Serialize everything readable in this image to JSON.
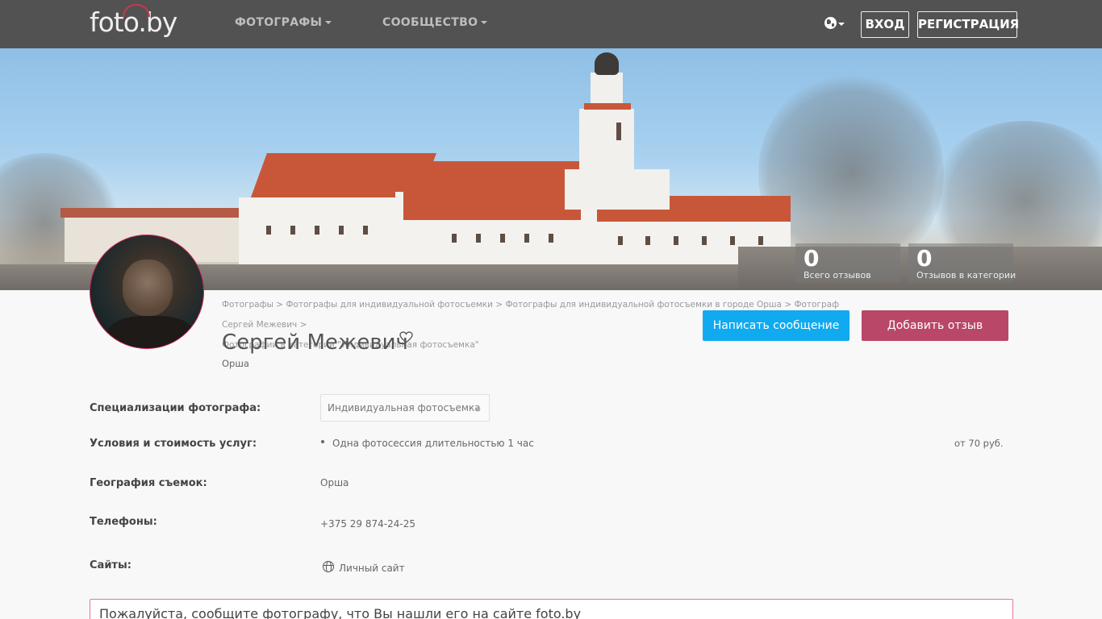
{
  "header": {
    "logo": "foto.by",
    "nav": [
      {
        "label": "ФОТОГРАФЫ"
      },
      {
        "label": "СООБЩЕСТВО"
      }
    ],
    "language_icon": "globe-icon",
    "login_label": "ВХОД",
    "register_label": "РЕГИСТРАЦИЯ"
  },
  "stats": [
    {
      "value": "0",
      "label": "Всего отзывов"
    },
    {
      "value": "0",
      "label": "Отзывов в категории"
    }
  ],
  "breadcrumb": {
    "items": [
      "Фотографы",
      "Фотографы для индивидуальной фотосъемки",
      "Фотографы для индивидуальной фотосъемки в городе Орша",
      "Фотограф Сергей Межевич"
    ],
    "separator": ">",
    "current": "Фотографии в категории \"Индивидуальная фотосъемка\""
  },
  "profile": {
    "name": "Сергей Межевич",
    "city": "Орша",
    "favorite_icon": "heart-icon"
  },
  "actions": {
    "message_label": "Написать сообщение",
    "review_label": "Добавить отзыв"
  },
  "details": {
    "specialization": {
      "label": "Специализации фотографа:",
      "selected": "Индивидуальная фотосъемка"
    },
    "services": {
      "label": "Условия и стоимость услуг:",
      "items": [
        {
          "name": "Одна фотосессия длительностью 1 час",
          "price": "от 70 руб."
        }
      ]
    },
    "geography": {
      "label": "География съемок:",
      "value": "Орша"
    },
    "phones": {
      "label": "Телефоны:",
      "value": "+375 29 874-24-25"
    },
    "sites": {
      "label": "Сайты:",
      "link_label": "Личный сайт",
      "icon": "globe-icon"
    }
  },
  "notice": {
    "text": "Пожалуйста, сообщите фотографу, что Вы нашли его на сайте foto.by"
  },
  "colors": {
    "topbar": "#525252",
    "message_button": "#10aaf0",
    "review_button": "#b94767",
    "notice_border": "#e07a8e"
  }
}
